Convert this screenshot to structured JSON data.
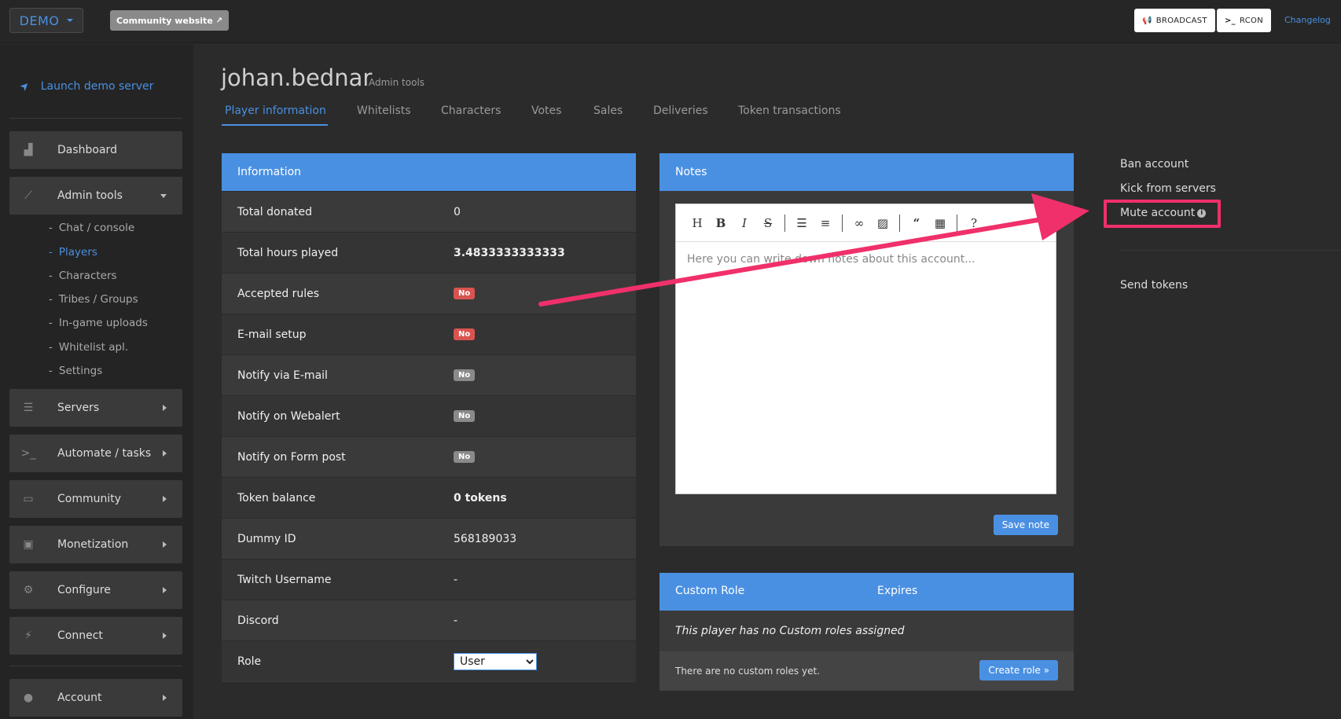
{
  "topbar": {
    "demo_label": "DEMO",
    "community_label": "Community website",
    "broadcast_label": "BROADCAST",
    "rcon_label": "RCON",
    "changelog_label": "Changelog"
  },
  "sidebar": {
    "launch_label": "Launch demo server",
    "items": [
      {
        "label": "Dashboard"
      },
      {
        "label": "Admin tools"
      },
      {
        "label": "Servers"
      },
      {
        "label": "Automate / tasks"
      },
      {
        "label": "Community"
      },
      {
        "label": "Monetization"
      },
      {
        "label": "Configure"
      },
      {
        "label": "Connect"
      },
      {
        "label": "Account"
      }
    ],
    "sub_items": [
      {
        "label": "Chat / console"
      },
      {
        "label": "Players"
      },
      {
        "label": "Characters"
      },
      {
        "label": "Tribes / Groups"
      },
      {
        "label": "In-game uploads"
      },
      {
        "label": "Whitelist apl."
      },
      {
        "label": "Settings"
      }
    ]
  },
  "header": {
    "title": "johan.bednar",
    "subtitle": "Admin tools"
  },
  "tabs": [
    {
      "label": "Player information"
    },
    {
      "label": "Whitelists"
    },
    {
      "label": "Characters"
    },
    {
      "label": "Votes"
    },
    {
      "label": "Sales"
    },
    {
      "label": "Deliveries"
    },
    {
      "label": "Token transactions"
    }
  ],
  "information": {
    "title": "Information",
    "rows": [
      {
        "label": "Total donated",
        "value": "0"
      },
      {
        "label": "Total hours played",
        "value": "3.4833333333333"
      },
      {
        "label": "Accepted rules",
        "value": "No"
      },
      {
        "label": "E-mail setup",
        "value": "No"
      },
      {
        "label": "Notify via E-mail",
        "value": "No"
      },
      {
        "label": "Notify on Webalert",
        "value": "No"
      },
      {
        "label": "Notify on Form post",
        "value": "No"
      },
      {
        "label": "Token balance",
        "value": "0 tokens"
      },
      {
        "label": "Dummy ID",
        "value": "568189033"
      },
      {
        "label": "Twitch Username",
        "value": "-"
      },
      {
        "label": "Discord",
        "value": "-"
      },
      {
        "label": "Role",
        "value": "User"
      }
    ]
  },
  "notes": {
    "title": "Notes",
    "placeholder": "Here you can write down notes about this account...",
    "save_label": "Save note"
  },
  "custom_role": {
    "col_role": "Custom Role",
    "col_expires": "Expires",
    "empty_text": "This player has no Custom roles assigned",
    "footer_text": "There are no custom roles yet.",
    "create_label": "Create role »"
  },
  "actions": {
    "ban": "Ban account",
    "kick": "Kick from servers",
    "mute": "Mute account",
    "send_tokens": "Send tokens"
  },
  "colors": {
    "accent": "#4a90e2",
    "highlight": "#f0306a",
    "badge_red": "#d9534f",
    "badge_grey": "#8a8a8a"
  }
}
